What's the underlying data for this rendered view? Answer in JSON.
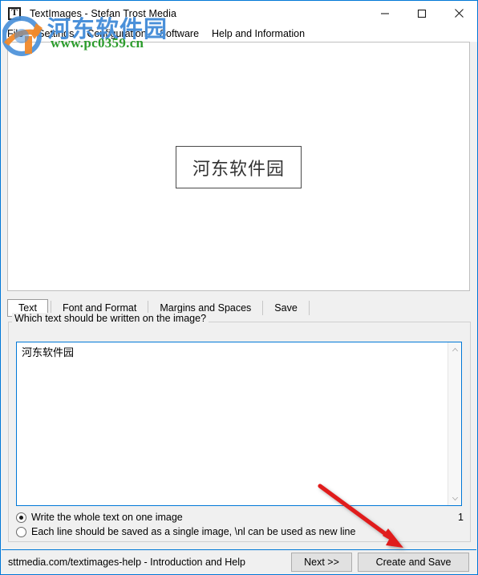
{
  "window": {
    "title": "TextImages - Stefan Trost Media",
    "icon": "app-t-icon",
    "controls": {
      "minimize": "minimize-icon",
      "maximize": "maximize-icon",
      "close": "close-icon"
    }
  },
  "menu": {
    "items": [
      {
        "label": "File"
      },
      {
        "label": "Settings"
      },
      {
        "label": "Configuration"
      },
      {
        "label": "Software"
      },
      {
        "label": "Help and Information"
      }
    ]
  },
  "watermark": {
    "chinese": "河东软件园",
    "url": "www.pc0359.cn",
    "logo": "pc0359-logo-icon",
    "colors": {
      "chinese": "#4a90d9",
      "url": "#2c9c2c",
      "logo_blue": "#3f8fd0",
      "logo_orange": "#f0892a"
    }
  },
  "preview": {
    "image_text": "河东软件园"
  },
  "tabs": [
    {
      "label": "Text",
      "active": true
    },
    {
      "label": "Font and Format",
      "active": false
    },
    {
      "label": "Margins and Spaces",
      "active": false
    },
    {
      "label": "Save",
      "active": false
    }
  ],
  "text_tab": {
    "group_label": "Which text should be written on the image?",
    "textarea_value": "河东软件园",
    "options": [
      {
        "label": "Write the whole text on one image",
        "checked": true
      },
      {
        "label": "Each line should be saved as a single image, \\nl can be used as new line",
        "checked": false
      }
    ],
    "image_count": "1"
  },
  "footer": {
    "status": "sttmedia.com/textimages-help - Introduction and Help",
    "next_label": "Next >>",
    "create_label": "Create and Save"
  },
  "annotation": {
    "arrow_color": "#e01b1b"
  }
}
